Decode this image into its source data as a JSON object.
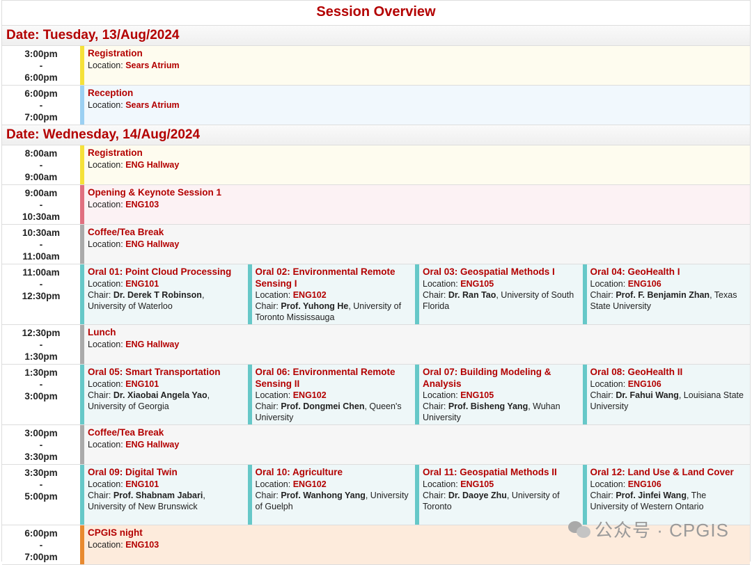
{
  "title": "Session Overview",
  "watermark": "公众号 · CPGIS",
  "days": [
    {
      "date": "Date: Tuesday, 13/Aug/2024",
      "slots": [
        {
          "start": "3:00pm",
          "end": "6:00pm",
          "height": 57,
          "sessions": [
            {
              "title": "Registration",
              "location": "Sears Atrium",
              "color": "yellow"
            }
          ]
        },
        {
          "start": "6:00pm",
          "end": "7:00pm",
          "height": 57,
          "sessions": [
            {
              "title": "Reception",
              "location": "Sears Atrium",
              "color": "blue"
            }
          ]
        }
      ]
    },
    {
      "date": "Date: Wednesday, 14/Aug/2024",
      "slots": [
        {
          "start": "8:00am",
          "end": "9:00am",
          "height": 57,
          "sessions": [
            {
              "title": "Registration",
              "location": "ENG Hallway",
              "color": "yellow"
            }
          ]
        },
        {
          "start": "9:00am",
          "end": "10:30am",
          "height": 57,
          "sessions": [
            {
              "title": "Opening & Keynote Session 1",
              "location": "ENG103",
              "color": "pink"
            }
          ]
        },
        {
          "start": "10:30am",
          "end": "11:00am",
          "height": 57,
          "sessions": [
            {
              "title": "Coffee/Tea Break",
              "location": "ENG Hallway",
              "color": "gray"
            }
          ]
        },
        {
          "start": "11:00am",
          "end": "12:30pm",
          "height": 87,
          "sessions": [
            {
              "title": "Oral 01: Point Cloud Processing",
              "location": "ENG101",
              "chair_title": "Dr. Derek T Robinson",
              "affiliation": ", University of Waterloo",
              "color": "teal"
            },
            {
              "title": "Oral 02: Environmental Remote Sensing I",
              "location": "ENG102",
              "chair_title": "Prof. Yuhong He",
              "affiliation": ", University of Toronto Mississauga",
              "color": "teal"
            },
            {
              "title": "Oral 03: Geospatial Methods I",
              "location": "ENG105",
              "chair_title": "Dr. Ran Tao",
              "affiliation": ", University of South Florida",
              "color": "teal"
            },
            {
              "title": "Oral 04: GeoHealth I",
              "location": "ENG106",
              "chair_title": "Prof. F. Benjamin Zhan",
              "affiliation": ", Texas State University",
              "color": "teal"
            }
          ]
        },
        {
          "start": "12:30pm",
          "end": "1:30pm",
          "height": 57,
          "sessions": [
            {
              "title": "Lunch",
              "location": "ENG Hallway",
              "color": "gray"
            }
          ]
        },
        {
          "start": "1:30pm",
          "end": "3:00pm",
          "height": 87,
          "sessions": [
            {
              "title": "Oral 05: Smart Transportation",
              "location": "ENG101",
              "chair_title": "Dr. Xiaobai Angela Yao",
              "affiliation": ", University of Georgia",
              "color": "teal"
            },
            {
              "title": "Oral 06: Environmental Remote Sensing II",
              "location": "ENG102",
              "chair_title": "Prof. Dongmei Chen",
              "affiliation": ", Queen's University",
              "color": "teal"
            },
            {
              "title": "Oral 07: Building Modeling & Analysis",
              "location": "ENG105",
              "chair_title": "Prof. Bisheng Yang",
              "affiliation": ", Wuhan University",
              "color": "teal"
            },
            {
              "title": "Oral 08: GeoHealth II",
              "location": "ENG106",
              "chair_title": "Dr. Fahui Wang",
              "affiliation": ", Louisiana State University",
              "color": "teal"
            }
          ]
        },
        {
          "start": "3:00pm",
          "end": "3:30pm",
          "height": 57,
          "sessions": [
            {
              "title": "Coffee/Tea Break",
              "location": "ENG Hallway",
              "color": "gray"
            }
          ]
        },
        {
          "start": "3:30pm",
          "end": "5:00pm",
          "height": 87,
          "sessions": [
            {
              "title": "Oral 09: Digital Twin",
              "location": "ENG101",
              "chair_title": "Prof. Shabnam Jabari",
              "affiliation": ", University of New Brunswick",
              "color": "teal"
            },
            {
              "title": "Oral 10: Agriculture",
              "location": "ENG102",
              "chair_title": "Prof. Wanhong Yang",
              "affiliation": ", University of Guelph",
              "color": "teal"
            },
            {
              "title": "Oral 11: Geospatial Methods II",
              "location": "ENG105",
              "chair_title": "Dr. Daoye Zhu",
              "affiliation": ", University of Toronto",
              "color": "teal"
            },
            {
              "title": "Oral 12: Land Use & Land Cover",
              "location": "ENG106",
              "chair_title": "Prof. Jinfei Wang",
              "affiliation": ", The University of Western Ontario",
              "color": "teal"
            }
          ]
        },
        {
          "start": "6:00pm",
          "end": "7:00pm",
          "height": 57,
          "sessions": [
            {
              "title": "CPGIS night",
              "location": "ENG103",
              "color": "orange"
            }
          ]
        }
      ]
    }
  ],
  "labels": {
    "location": "Location: ",
    "chair": "Chair: ",
    "dash": "-"
  }
}
